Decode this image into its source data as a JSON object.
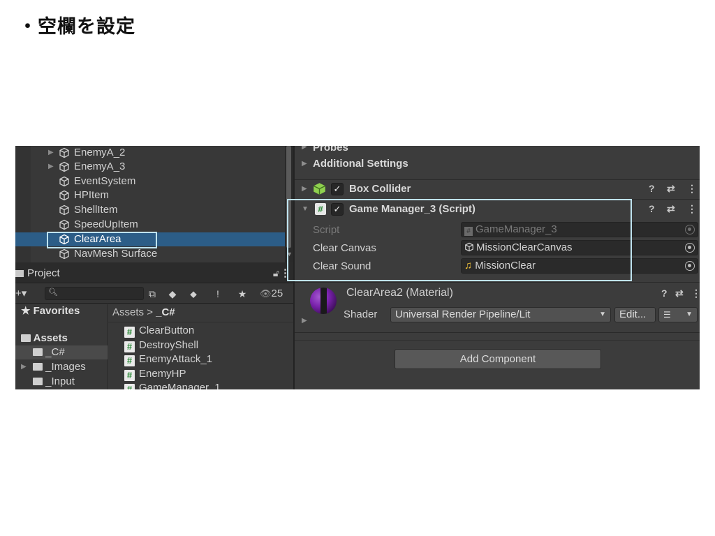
{
  "slide": {
    "title": "・空欄を設定"
  },
  "hierarchy": {
    "items": [
      {
        "label": "EnemyA_2",
        "expandable": true
      },
      {
        "label": "EnemyA_3",
        "expandable": true
      },
      {
        "label": "EventSystem",
        "expandable": false
      },
      {
        "label": "HPItem",
        "expandable": false
      },
      {
        "label": "ShellItem",
        "expandable": false
      },
      {
        "label": "SpeedUpItem",
        "expandable": false
      },
      {
        "label": "ClearArea",
        "expandable": false,
        "selected": true
      },
      {
        "label": "NavMesh Surface",
        "expandable": false
      }
    ]
  },
  "project": {
    "tab_label": "Project",
    "lock_icon": "lock-icon",
    "search": {
      "value": ""
    },
    "hidden_count": "25",
    "favorites_label": "Favorites",
    "assets_label": "Assets",
    "folders": [
      {
        "label": "_C#",
        "selected": true
      },
      {
        "label": "_Images",
        "expandable": true
      },
      {
        "label": "_Input"
      }
    ],
    "breadcrumb": {
      "root": "Assets",
      "sep": ">",
      "current": "_C#"
    },
    "files": [
      "ClearButton",
      "DestroyShell",
      "EnemyAttack_1",
      "EnemyHP",
      "GameManager_1"
    ]
  },
  "inspector": {
    "probes_label": "Probes",
    "additional_settings_label": "Additional Settings",
    "box_collider": {
      "label": "Box Collider",
      "enabled": true
    },
    "game_manager": {
      "label": "Game Manager_3 (Script)",
      "enabled": true,
      "props": [
        {
          "label": "Script",
          "value": "GameManager_3",
          "icon": "hash-icon",
          "disabled": true
        },
        {
          "label": "Clear Canvas",
          "value": "MissionClearCanvas",
          "icon": "cube-icon",
          "disabled": false
        },
        {
          "label": "Clear Sound",
          "value": "MissionClear",
          "icon": "music-icon",
          "disabled": false
        }
      ]
    },
    "material": {
      "title": "ClearArea2 (Material)",
      "shader_label": "Shader",
      "shader_value": "Universal Render Pipeline/Lit",
      "edit_label": "Edit..."
    },
    "add_component_label": "Add Component"
  },
  "colors": {
    "selection": "#2c5d87",
    "highlight_frame": "#bfe3ef",
    "collider_green": "#8fd14f",
    "music_yellow": "#f0c23a"
  }
}
